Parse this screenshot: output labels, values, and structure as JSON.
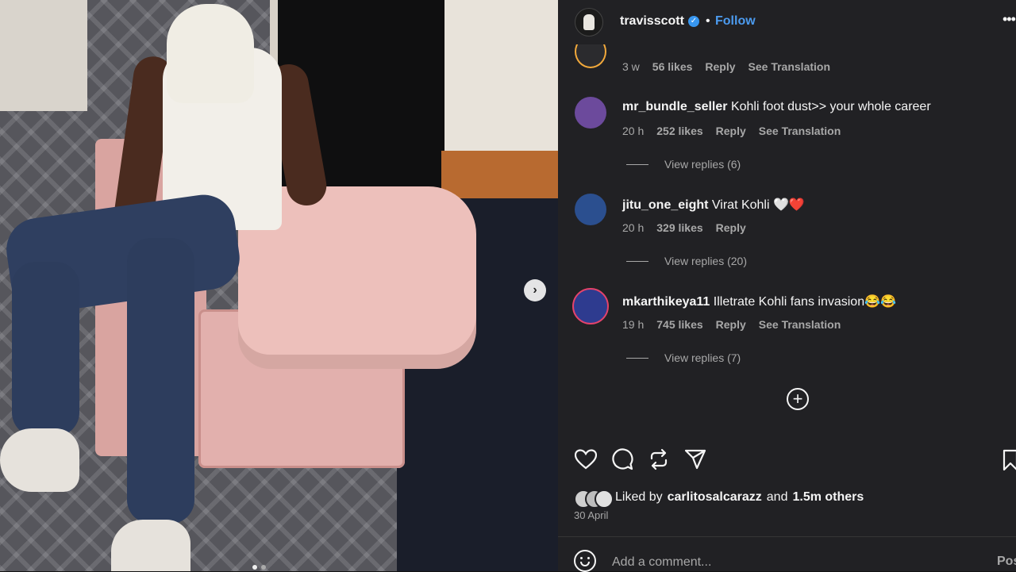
{
  "header": {
    "username": "travisscott",
    "separator": "•",
    "follow_label": "Follow",
    "more_label": "•••"
  },
  "carousel": {
    "next_glyph": "›",
    "dots": 2,
    "active_dot": 1
  },
  "partial_comment": {
    "time": "3 w",
    "likes": "56 likes",
    "reply": "Reply",
    "translation": "See Translation"
  },
  "comments": [
    {
      "username": "mr_bundle_seller",
      "text": "Kohli foot dust>> your whole career",
      "time": "20 h",
      "likes": "252 likes",
      "reply": "Reply",
      "translation": "See Translation",
      "view_replies": "View replies (6)",
      "avatar_color": "#6c4a9c"
    },
    {
      "username": "jitu_one_eight",
      "text": "Virat Kohli 🤍❤️",
      "time": "20 h",
      "likes": "329 likes",
      "reply": "Reply",
      "view_replies": "View replies (20)",
      "avatar_color": "#2b4f8f"
    },
    {
      "username": "mkarthikeya11",
      "text": "Illetrate Kohli fans invasion😂😂",
      "time": "19 h",
      "likes": "745 likes",
      "reply": "Reply",
      "translation": "See Translation",
      "view_replies": "View replies (7)",
      "avatar_color": "#2e3b8f"
    }
  ],
  "load_more_label": "+",
  "icons": {
    "like": "heart-icon",
    "comment": "comment-icon",
    "repost": "repost-icon",
    "share": "share-icon",
    "save": "bookmark-icon",
    "emoji": "emoji-icon"
  },
  "likes_summary": {
    "prefix": "Liked by",
    "user": "carlitosalcarazz",
    "middle": "and",
    "others": "1.5m others"
  },
  "post_date": "30 April",
  "comment_box": {
    "placeholder": "Add a comment...",
    "post_label": "Post"
  },
  "colors": {
    "panel_bg": "#212124",
    "link_blue": "#4c9bef",
    "verified_blue": "#3897f0",
    "story_ring": "#f2a93b"
  }
}
